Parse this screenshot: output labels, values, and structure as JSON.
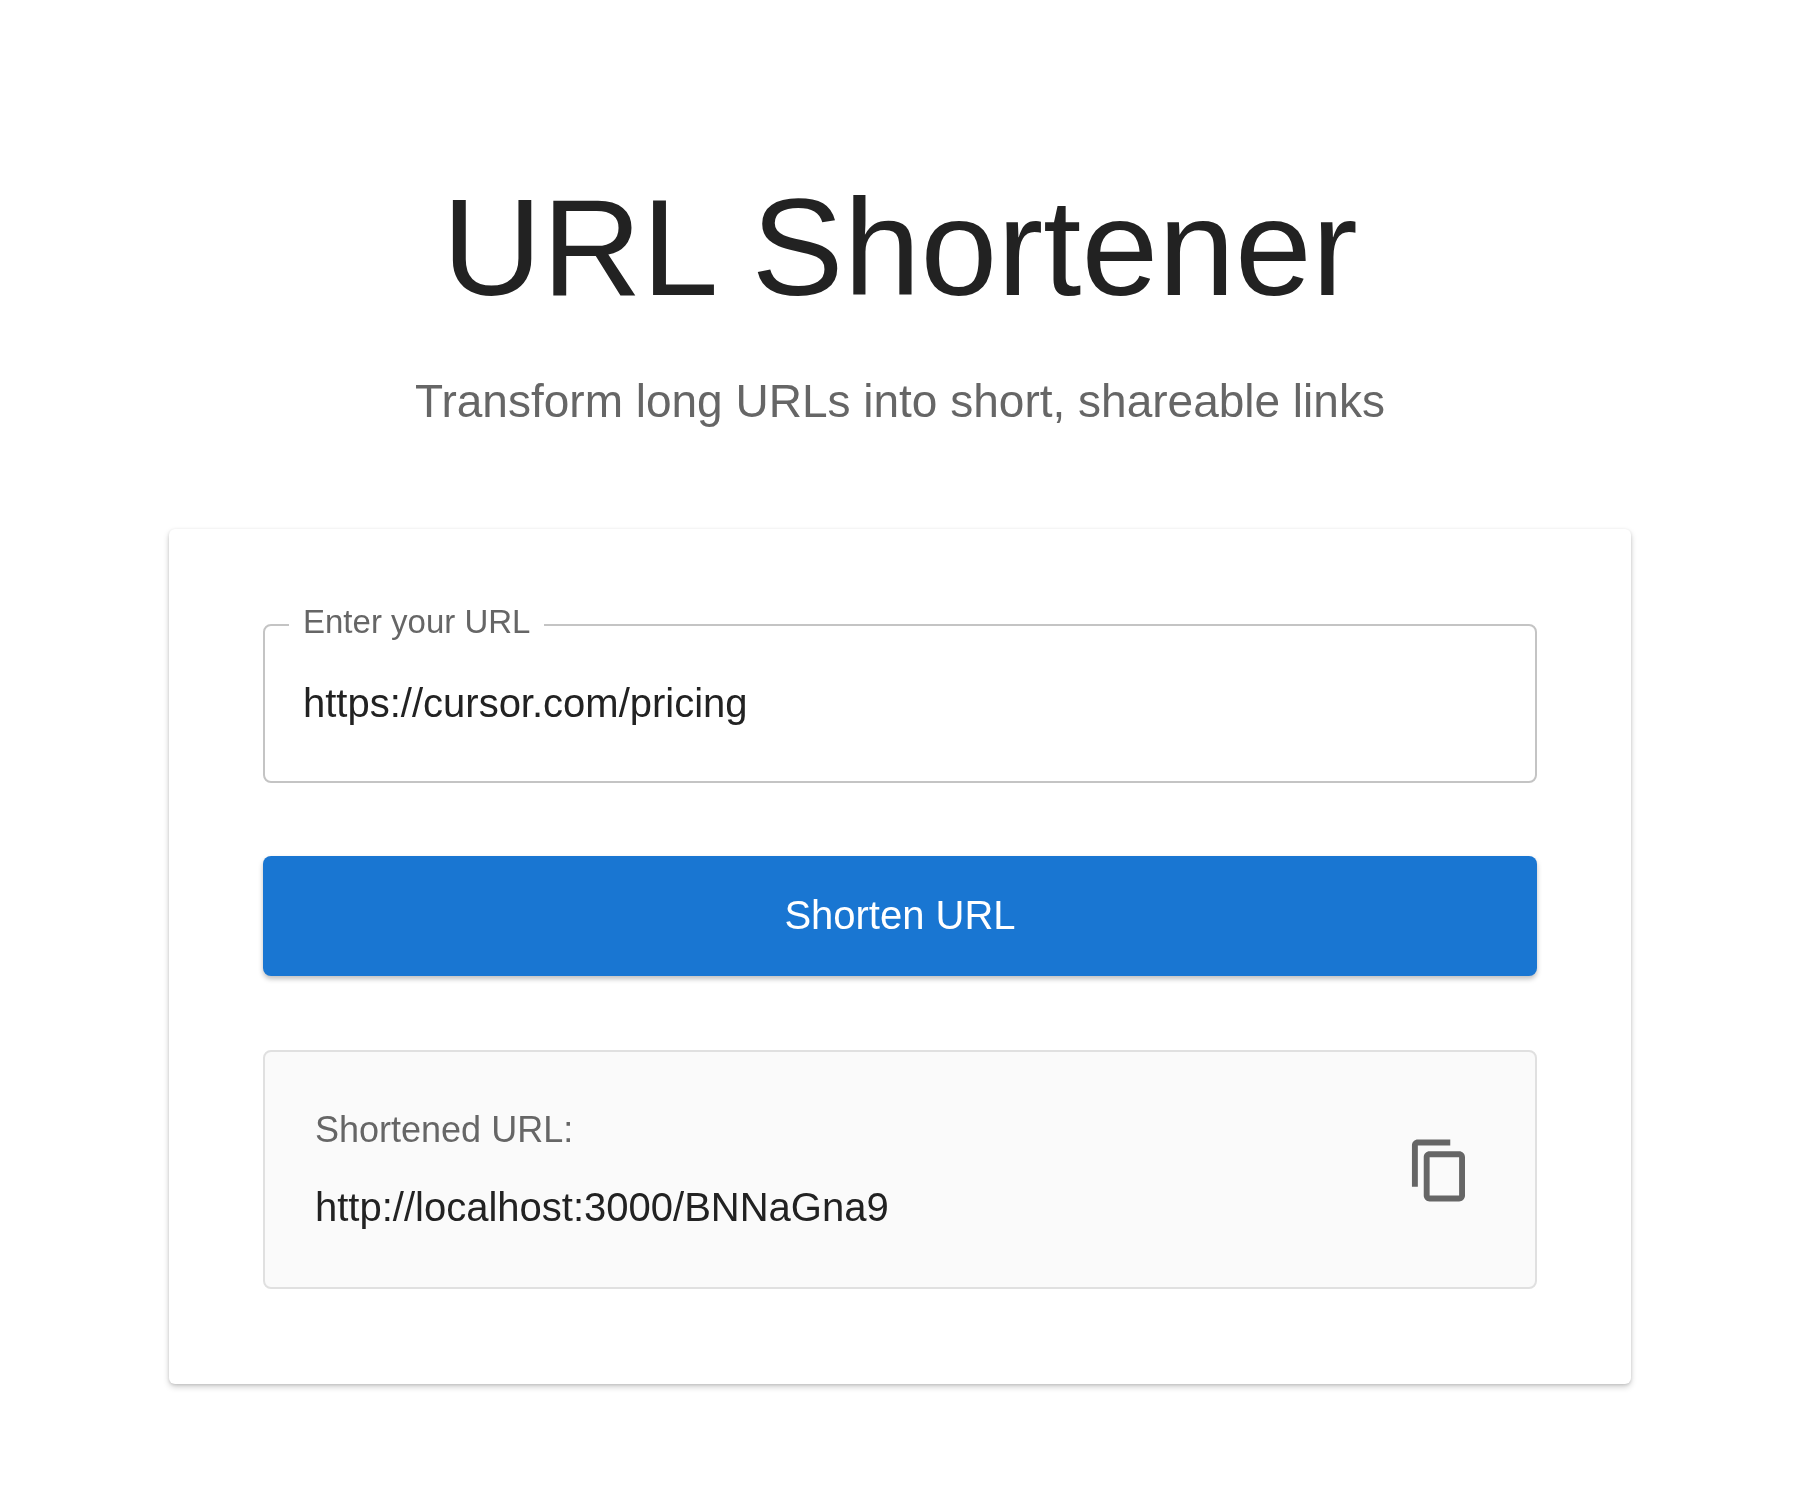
{
  "title": "URL Shortener",
  "subtitle": "Transform long URLs into short, shareable links",
  "url_field": {
    "label": "Enter your URL",
    "value": "https://cursor.com/pricing"
  },
  "submit_button": "Shorten URL",
  "result": {
    "label": "Shortened URL:",
    "value": "http://localhost:3000/BNNaGna9"
  }
}
